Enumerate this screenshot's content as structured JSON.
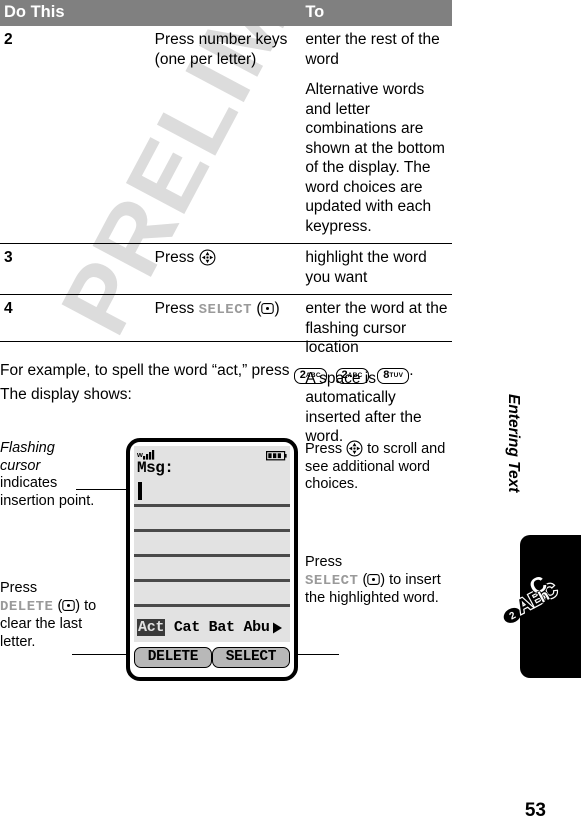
{
  "page": {
    "number": "53",
    "watermark": "PRELIMINARY",
    "side_tab_title": "Entering Text",
    "side_tab_icon": "abc-text-entry-icon"
  },
  "table": {
    "headers": {
      "do_this": "Do This",
      "to": "To"
    },
    "rows": [
      {
        "num": "2",
        "do_this": [
          "Press number keys (one per letter)"
        ],
        "to": [
          "enter the rest of the word",
          "Alternative words and letter combinations are shown at the bottom of the display. The word choices are updated with each keypress."
        ]
      },
      {
        "num": "3",
        "do_this_prefix": "Press ",
        "do_this_key": "nav-key-icon",
        "to": [
          "highlight the word you want"
        ]
      },
      {
        "num": "4",
        "do_this_prefix": "Press ",
        "do_this_softkey": "SELECT",
        "do_this_key": "select-key-icon",
        "to": [
          "enter the word at the flashing cursor location",
          "A space is automatically inserted after the word."
        ]
      }
    ]
  },
  "example": {
    "text_before": "For example, to spell the word “act,” press ",
    "keys": [
      {
        "digit": "2",
        "letters": "ABC"
      },
      {
        "digit": "2",
        "letters": "ABC"
      },
      {
        "digit": "8",
        "letters": "TUV"
      }
    ],
    "text_after": ".",
    "text_line2": "The display shows:"
  },
  "figure": {
    "annotations": {
      "left_1": {
        "italic": "Flashing cursor",
        "rest": " indicates insertion point."
      },
      "left_2": {
        "before": "Press ",
        "softkey": "DELETE",
        "key": "select-key-icon",
        "after": " to clear the last letter."
      },
      "right_1": {
        "before": "Press ",
        "key": "nav-key-icon",
        "after": " to scroll and see additional word choices."
      },
      "right_2": {
        "before": "Press ",
        "softkey": "SELECT",
        "key": "select-key-icon",
        "after": " to insert the highlighted word."
      }
    },
    "phone": {
      "status": {
        "signal_icon": "signal-strength-icon",
        "battery_icon": "battery-full-icon"
      },
      "msg_label": "Msg:",
      "cursor": "text-cursor",
      "word_choices": {
        "selected": "Act",
        "alternatives": [
          "Cat",
          "Bat",
          "Abu"
        ],
        "more_arrow": "right-arrow-icon"
      },
      "softkeys": {
        "left": "DELETE",
        "right": "SELECT"
      }
    }
  },
  "colors": {
    "header_bar": "#808080",
    "screen_bg": "#e2e2e2",
    "screen_rule": "#4a4a4a",
    "softkey_fill": "#b8b8b8",
    "selected_word_bg": "#3a3a3a",
    "softkey_label": "#9a9a9a",
    "watermark": "#dcdcdc"
  }
}
